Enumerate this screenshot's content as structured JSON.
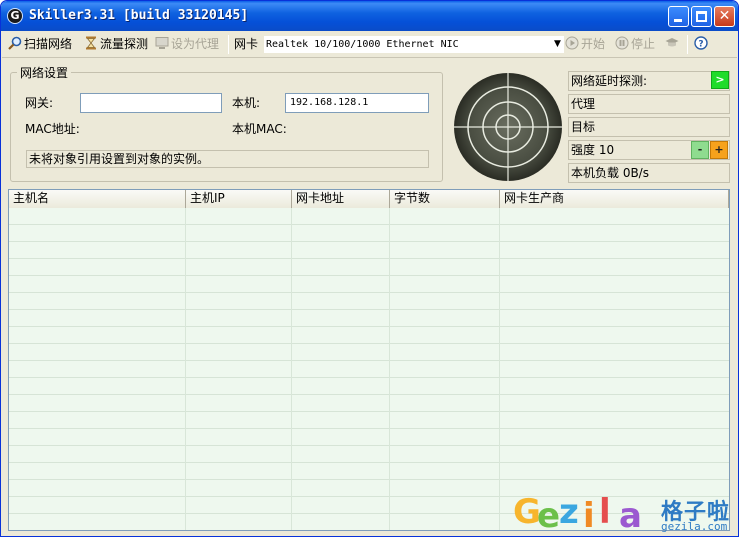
{
  "window": {
    "title": "Skiller3.31 [build 33120145]",
    "app_icon_letter": "G",
    "minimize_icon": "minimize-icon",
    "maximize_icon": "maximize-icon",
    "close_symbol": "✕"
  },
  "toolbar": {
    "scan_label": "扫描网络",
    "sniff_label": "流量探测",
    "proxy_label": "设为代理",
    "nic_label": "网卡",
    "nic_value": "Realtek 10/100/1000 Ethernet NIC",
    "start_label": "开始",
    "stop_label": "停止"
  },
  "network": {
    "group_title": "网络设置",
    "gateway_label": "网关:",
    "gateway_value": "",
    "local_label": "本机:",
    "local_value": "192.168.128.1",
    "mac_label": "MAC地址:",
    "local_mac_label": "本机MAC:",
    "status_message": "未将对象引用设置到对象的实例。"
  },
  "info_panel": {
    "latency_label": "网络延时探测:",
    "go_symbol": ">",
    "proxy_label": "代理",
    "target_label": "目标",
    "strength_label": "强度 10",
    "minus_symbol": "-",
    "plus_symbol": "+",
    "load_label": "本机负载  0B/s"
  },
  "table": {
    "columns": [
      "主机名",
      "主机IP",
      "网卡地址",
      "字节数",
      "网卡生产商"
    ]
  },
  "watermark": {
    "letters": [
      "G",
      "e",
      "z",
      "i",
      "l",
      "a"
    ],
    "cn": "格子啦",
    "url": "gezila.com"
  },
  "colors": {
    "title_bar": "#0A5FE8",
    "window_bg": "#ECE9D8",
    "go_green": "#1fdc2a",
    "plus_orange": "#f6a21c",
    "radar_dark": "#3a3d33",
    "row_bg": "#EEF8EE"
  }
}
